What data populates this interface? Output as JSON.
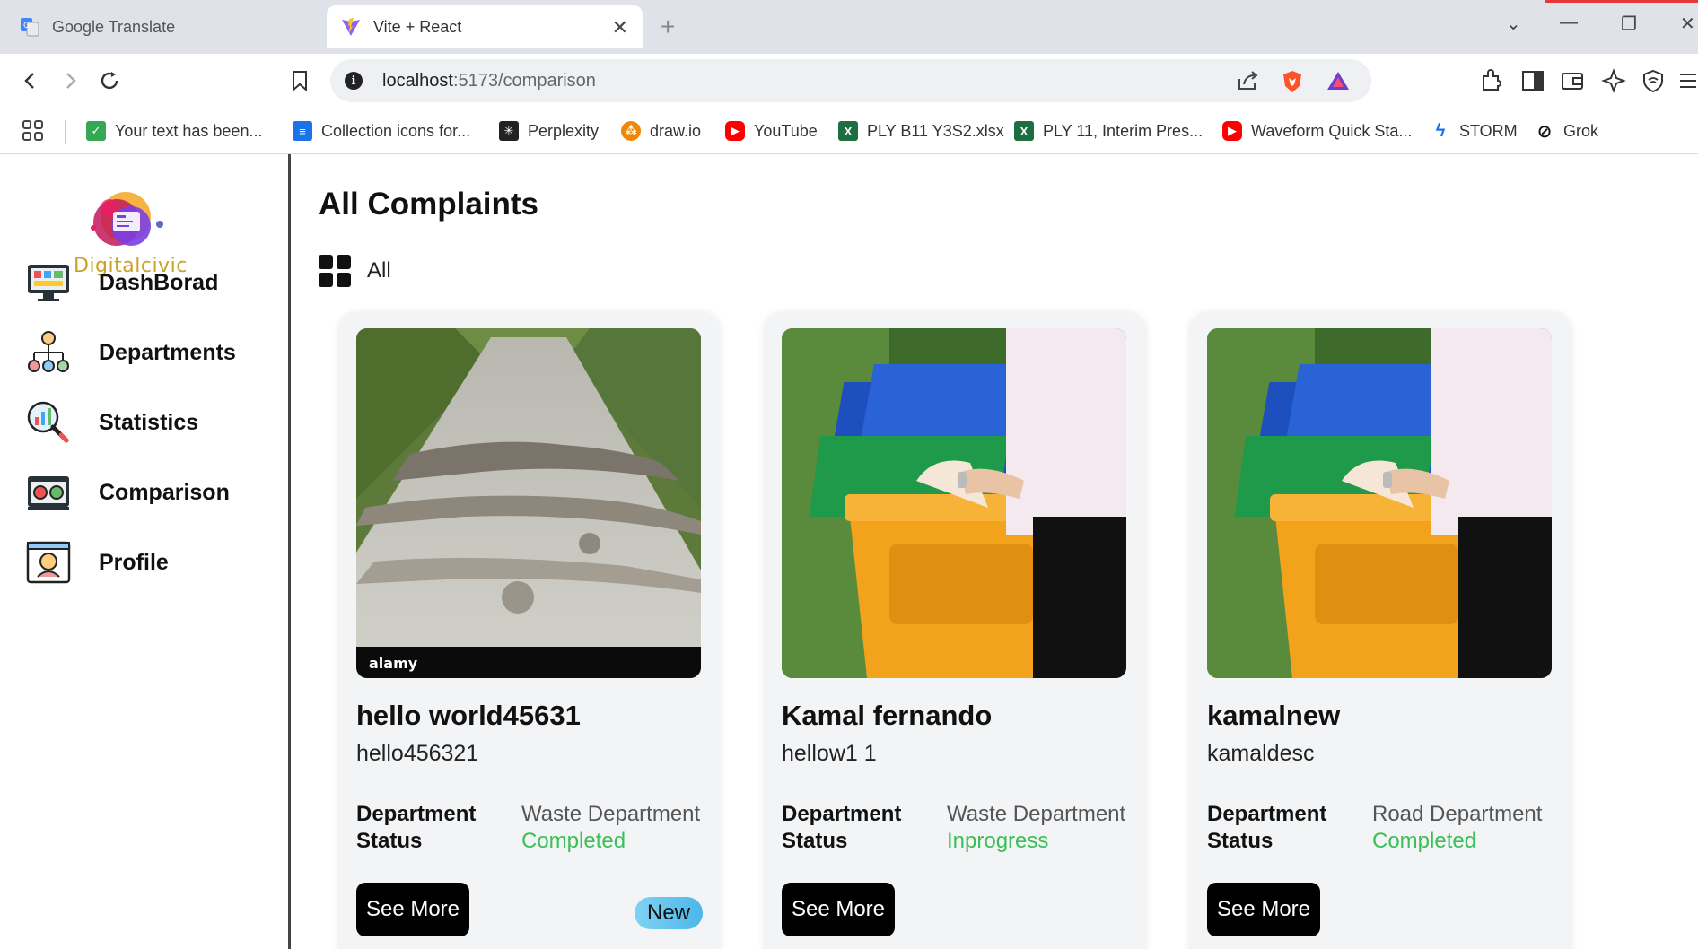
{
  "browser": {
    "tabs": [
      {
        "title": "Google Translate",
        "icon": "google-translate-icon",
        "active": false
      },
      {
        "title": "Vite + React",
        "icon": "vite-icon",
        "active": true
      }
    ],
    "url_host": "localhost",
    "url_path": ":5173/comparison",
    "bookmarks": [
      {
        "label": "Your text has been...",
        "icon": "check-icon",
        "color": "#34a853"
      },
      {
        "label": "Collection icons for...",
        "icon": "doc-icon",
        "color": "#1a73e8"
      },
      {
        "label": "Perplexity",
        "icon": "perplexity-icon",
        "color": "#222222"
      },
      {
        "label": "draw.io",
        "icon": "drawio-icon",
        "color": "#f08705"
      },
      {
        "label": "YouTube",
        "icon": "youtube-icon",
        "color": "#ff0000"
      },
      {
        "label": "PLY B11 Y3S2.xlsx",
        "icon": "excel-icon",
        "color": "#1d6f42"
      },
      {
        "label": "PLY 11, Interim Pres...",
        "icon": "excel-icon",
        "color": "#1d6f42"
      },
      {
        "label": "Waveform Quick Sta...",
        "icon": "youtube-icon",
        "color": "#ff0000"
      },
      {
        "label": "STORM",
        "icon": "lightning-icon",
        "color": "#1a73e8"
      },
      {
        "label": "Grok",
        "icon": "grok-icon",
        "color": "#111111"
      }
    ]
  },
  "app": {
    "logo_text": "Digitalcivic",
    "nav": [
      {
        "label": "DashBorad",
        "icon": "dashboard-icon"
      },
      {
        "label": "Departments",
        "icon": "departments-icon"
      },
      {
        "label": "Statistics",
        "icon": "statistics-icon"
      },
      {
        "label": "Comparison",
        "icon": "comparison-icon"
      },
      {
        "label": "Profile",
        "icon": "profile-icon"
      }
    ]
  },
  "main": {
    "title": "All Complaints",
    "filter_label": "All",
    "labels": {
      "department": "Department",
      "status": "Status",
      "see_more": "See More",
      "new_badge": "New"
    },
    "status_color": "#3cbf58",
    "cards": [
      {
        "title": "hello world45631",
        "description": "hello456321",
        "department": "Waste Department",
        "status": "Completed",
        "image": "road-image",
        "watermark": "alamy",
        "new": true
      },
      {
        "title": "Kamal fernando",
        "description": "hellow1 1",
        "department": "Waste Department",
        "status": "Inprogress",
        "image": "waste-bin-image",
        "new": false
      },
      {
        "title": "kamalnew",
        "description": "kamaldesc",
        "department": "Road Department",
        "status": "Completed",
        "image": "waste-bin-image",
        "new": false
      }
    ]
  }
}
